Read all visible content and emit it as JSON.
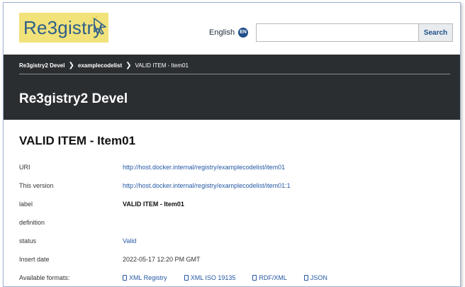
{
  "header": {
    "logo_text": "Re3gistry",
    "language_label": "English",
    "language_code": "EN",
    "search_placeholder": "",
    "search_button": "Search"
  },
  "breadcrumb": {
    "items": [
      "Re3gistry2 Devel",
      "examplecodelist",
      "VALID ITEM - Item01"
    ]
  },
  "registry_title": "Re3gistry2 Devel",
  "item": {
    "title": "VALID ITEM - Item01",
    "fields": [
      {
        "label": "URI",
        "value": "http://host.docker.internal/registry/examplecodelist/item01"
      },
      {
        "label": "This version",
        "value": "http://host.docker.internal/registry/examplecodelist/item01:1"
      },
      {
        "label": "label",
        "value": "VALID ITEM - Item01"
      },
      {
        "label": "definition",
        "value": ""
      },
      {
        "label": "status",
        "value": "Valid"
      },
      {
        "label": "Insert date",
        "value": "2022-05-17 12:20 PM GMT"
      },
      {
        "label": "Available formats:",
        "value": ""
      }
    ],
    "formats": [
      "XML Registry",
      "XML ISO 19135",
      "RDF/XML",
      "JSON"
    ]
  },
  "colors": {
    "logo_bg": "#f2e27a",
    "band": "#2b2e31",
    "link": "#2558a4"
  }
}
